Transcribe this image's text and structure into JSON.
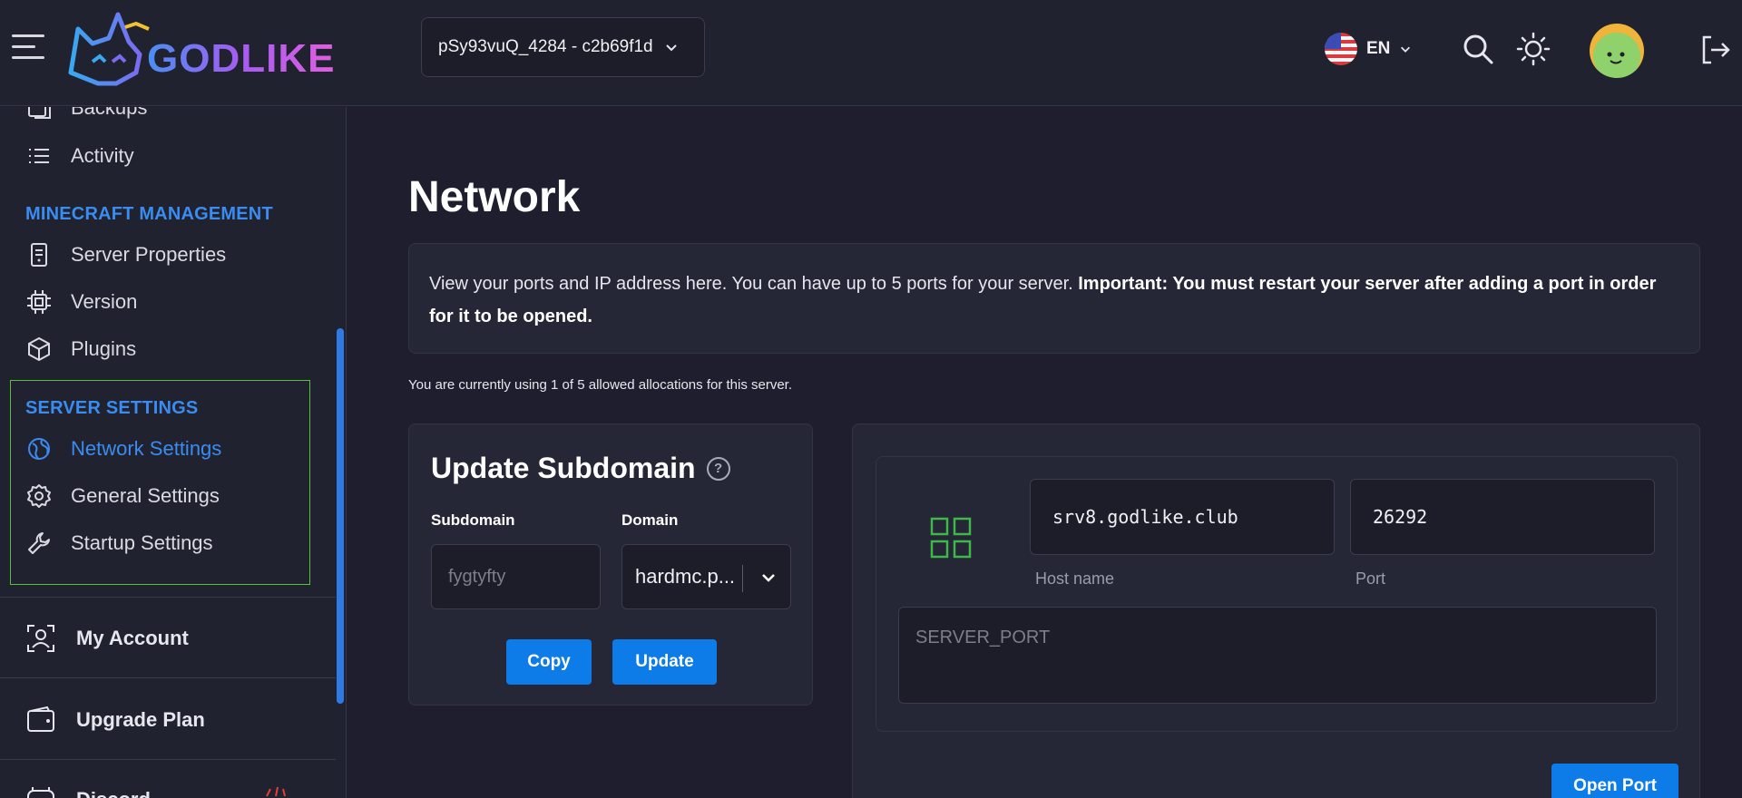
{
  "header": {
    "logo_text": "GODLIKE",
    "server_selector": "pSy93vuQ_4284 - c2b69f1d",
    "language": "EN",
    "icons": [
      "menu-icon",
      "search-icon",
      "theme-sun-icon",
      "logout-icon"
    ]
  },
  "sidebar": {
    "items_top": [
      {
        "label": "Backups",
        "icon": "backup-icon"
      },
      {
        "label": "Activity",
        "icon": "list-icon"
      }
    ],
    "minecraft_header": "MINECRAFT MANAGEMENT",
    "minecraft_items": [
      {
        "label": "Server Properties",
        "icon": "file-icon"
      },
      {
        "label": "Version",
        "icon": "chip-icon"
      },
      {
        "label": "Plugins",
        "icon": "package-icon"
      }
    ],
    "settings_header": "SERVER SETTINGS",
    "settings_items": [
      {
        "label": "Network Settings",
        "icon": "globe-icon",
        "active": true
      },
      {
        "label": "General Settings",
        "icon": "gear-icon"
      },
      {
        "label": "Startup Settings",
        "icon": "wrench-icon"
      }
    ],
    "my_account": "My Account",
    "upgrade_plan": "Upgrade Plan",
    "discord": "Discord"
  },
  "main": {
    "title": "Network",
    "info_text": "View your ports and IP address here. You can have up to 5 ports for your server. ",
    "info_bold": "Important: You must restart your server after adding a port in order for it to be opened.",
    "allocation_text": "You are currently using 1 of 5 allowed allocations for this server.",
    "subdomain_card": {
      "title": "Update Subdomain",
      "help": "?",
      "subdomain_label": "Subdomain",
      "subdomain_placeholder": "fygtyfty",
      "domain_label": "Domain",
      "domain_value": "hardmc.p...",
      "copy_button": "Copy",
      "update_button": "Update"
    },
    "allocation": {
      "host": "srv8.godlike.club",
      "host_caption": "Host name",
      "port": "26292",
      "port_caption": "Port",
      "notes_placeholder": "SERVER_PORT",
      "open_port_button": "Open Port"
    }
  },
  "colors": {
    "accent": "#0d7be8",
    "active_link": "#3a8cf0",
    "highlight_border": "#55c23a",
    "allocation_icon": "#3fb84a"
  }
}
